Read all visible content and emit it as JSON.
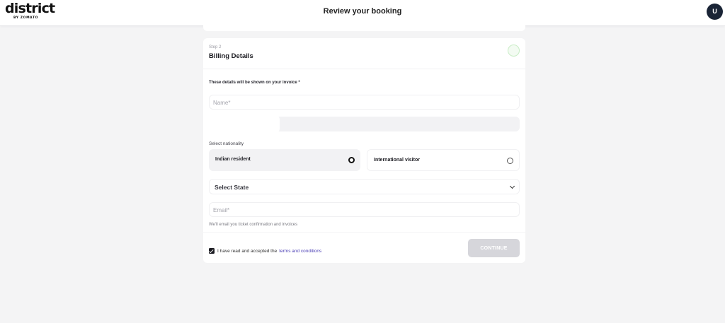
{
  "header": {
    "logo_text": "district",
    "logo_sub": "BY ZOMATO",
    "title": "Review your booking",
    "avatar_letter": "U"
  },
  "billing": {
    "step": "Step 2",
    "title": "Billing Details",
    "invoice_note": "These details will be shown on your invoice *",
    "name_placeholder": "Name*",
    "nationality_label": "Select nationality",
    "options": [
      {
        "label": "Indian resident",
        "selected": true
      },
      {
        "label": "International visitor",
        "selected": false
      }
    ],
    "state_placeholder": "Select State",
    "email_placeholder": "Email*",
    "email_hint": "We'll email you ticket confirmation and invoices",
    "terms_text": "I have read and accepted the",
    "terms_link": "terms and conditions",
    "terms_checked": true,
    "continue_label": "CONTINUE"
  },
  "colors": {
    "page_bg": "#f4f4f5",
    "button_disabled": "#d6d6db",
    "link": "#4b3fb5",
    "status_circle": "#c9edc6"
  }
}
